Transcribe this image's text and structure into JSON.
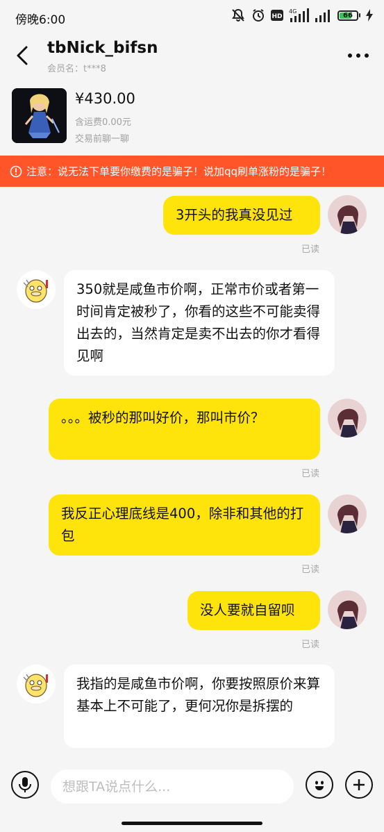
{
  "status_bar": {
    "time": "傍晚6:00",
    "network": "4G",
    "hd": "HD",
    "battery": "66",
    "battery_level": 0.66,
    "icons": [
      "mute-icon",
      "alarm-icon",
      "hd-icon",
      "signal-icon",
      "signal-icon",
      "battery-icon",
      "charging-icon"
    ]
  },
  "header": {
    "name": "tbNick_bifsn",
    "member_id": "会员名：t***8",
    "back_icon": "chevron-left-icon",
    "more_icon": "more-dots-icon"
  },
  "product": {
    "price": "¥430.00",
    "shipping": "含运费0.00元",
    "cta": "交易前聊一聊"
  },
  "warning": {
    "text": "注意：说无法下单要你缴费的是骗子！说加qq刷单涨粉的是骗子！",
    "icon": "warning-icon",
    "color": "#ff5528"
  },
  "messages": [
    {
      "sender": "me",
      "text": "3开头的我真没见过",
      "status": "已读"
    },
    {
      "sender": "them",
      "text": "350就是咸鱼市价啊，正常市价或者第一时间肯定被秒了，你看的这些不可能卖得出去的，当然肯定是卖不出去的你才看得见啊"
    },
    {
      "sender": "me",
      "text": "。。。被秒的那叫好价，那叫市价？",
      "status": "已读"
    },
    {
      "sender": "me",
      "text": "我反正心理底线是400，除非和其他的打包",
      "status": "已读"
    },
    {
      "sender": "me",
      "text": "没人要就自留呗",
      "status": "已读"
    },
    {
      "sender": "them",
      "text": "我指的是咸鱼市价啊，你要按照原价来算基本上不可能了，更何况你是拆摆的"
    }
  ],
  "input": {
    "placeholder": "想跟TA说点什么...",
    "voice_icon": "microphone-icon",
    "emoji_icon": "emoji-icon",
    "add_icon": "plus-icon"
  },
  "colors": {
    "my_bubble": "#ffe40c",
    "their_bubble": "#ffffff",
    "background": "#f5f5f5"
  }
}
